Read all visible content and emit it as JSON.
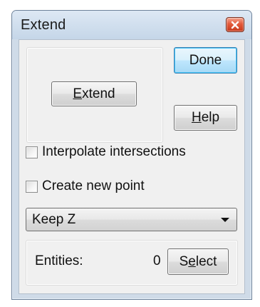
{
  "window": {
    "title": "Extend",
    "close_icon": "close-icon",
    "close_color": "#e04a2a"
  },
  "buttons": {
    "extend": {
      "prefix": "",
      "hotkey": "E",
      "suffix": "xtend"
    },
    "done": {
      "label": "Done"
    },
    "help": {
      "prefix": "",
      "hotkey": "H",
      "suffix": "elp"
    },
    "select": {
      "prefix": "S",
      "hotkey": "e",
      "suffix": "lect"
    }
  },
  "options": {
    "interpolate": {
      "label": "Interpolate intersections",
      "checked": false
    },
    "create_point": {
      "label": "Create new point",
      "checked": false
    }
  },
  "z_mode": {
    "selected": "Keep Z"
  },
  "entities": {
    "label": "Entities:",
    "count": "0"
  }
}
